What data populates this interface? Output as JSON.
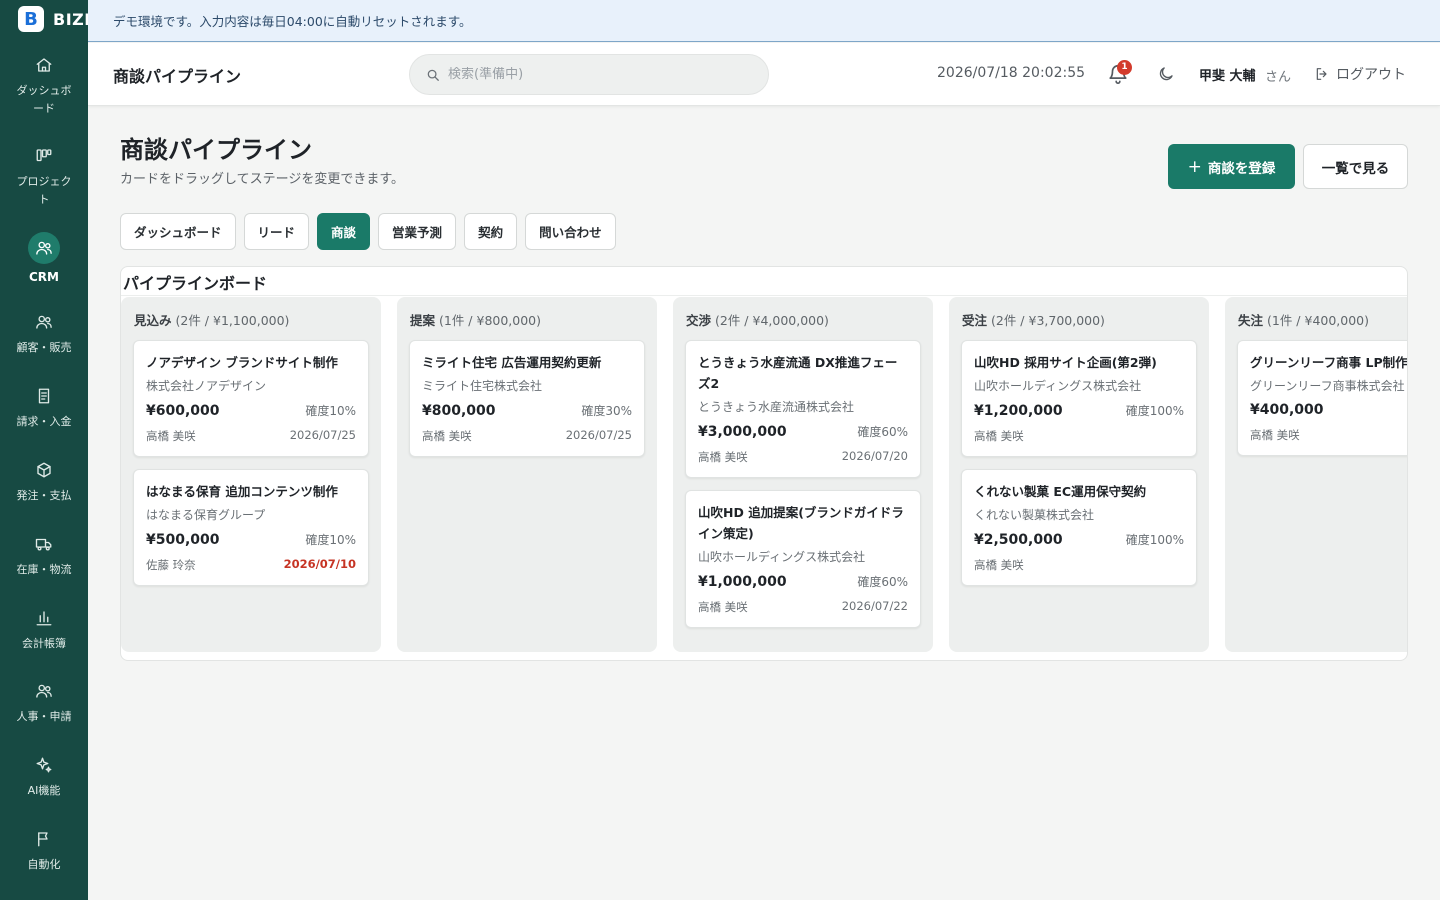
{
  "app": {
    "logo_letter": "B",
    "logo_text": "BIZR"
  },
  "banner": {
    "text": "デモ環境です。入力内容は毎日04:00に自動リセットされます。"
  },
  "sidebar": {
    "items": [
      {
        "label": "ダッシュボード",
        "icon": "home-icon"
      },
      {
        "label": "プロジェクト",
        "icon": "kanban-icon"
      },
      {
        "label": "CRM",
        "icon": "users-icon",
        "active": true
      },
      {
        "label": "顧客・販売",
        "icon": "users-icon"
      },
      {
        "label": "請求・入金",
        "icon": "invoice-icon"
      },
      {
        "label": "発注・支払",
        "icon": "box-icon"
      },
      {
        "label": "在庫・物流",
        "icon": "truck-icon"
      },
      {
        "label": "会計帳簿",
        "icon": "chart-icon"
      },
      {
        "label": "人事・申請",
        "icon": "people-icon"
      },
      {
        "label": "AI機能",
        "icon": "sparkle-icon"
      },
      {
        "label": "自動化",
        "icon": "flag-icon"
      }
    ]
  },
  "header": {
    "title": "商談パイプライン",
    "search_placeholder": "検索(準備中)",
    "datetime": "2026/07/18 20:02:55",
    "notification_count": "1",
    "user_name": "甲斐 大輔",
    "user_suffix": "さん",
    "logout_label": "ログアウト"
  },
  "page": {
    "title": "商談パイプライン",
    "subtitle": "カードをドラッグしてステージを変更できます。",
    "primary_button": "商談を登録",
    "primary_button_icon": "+",
    "secondary_button": "一覧で見る"
  },
  "tabs": [
    {
      "label": "ダッシュボード"
    },
    {
      "label": "リード"
    },
    {
      "label": "商談",
      "active": true
    },
    {
      "label": "営業予測"
    },
    {
      "label": "契約"
    },
    {
      "label": "問い合わせ"
    }
  ],
  "board": {
    "title": "パイプラインボード",
    "lanes": [
      {
        "name": "見込み",
        "summary": "(2件 / ¥1,100,000)",
        "cards": [
          {
            "title": "ノアデザイン ブランドサイト制作",
            "company": "株式会社ノアデザイン",
            "amount": "¥600,000",
            "probability": "確度10%",
            "owner": "高橋 美咲",
            "date": "2026/07/25",
            "overdue": false
          },
          {
            "title": "はなまる保育 追加コンテンツ制作",
            "company": "はなまる保育グループ",
            "amount": "¥500,000",
            "probability": "確度10%",
            "owner": "佐藤 玲奈",
            "date": "2026/07/10",
            "overdue": true
          }
        ]
      },
      {
        "name": "提案",
        "summary": "(1件 / ¥800,000)",
        "cards": [
          {
            "title": "ミライト住宅 広告運用契約更新",
            "company": "ミライト住宅株式会社",
            "amount": "¥800,000",
            "probability": "確度30%",
            "owner": "高橋 美咲",
            "date": "2026/07/25",
            "overdue": false
          }
        ]
      },
      {
        "name": "交渉",
        "summary": "(2件 / ¥4,000,000)",
        "cards": [
          {
            "title": "とうきょう水産流通 DX推進フェーズ2",
            "company": "とうきょう水産流通株式会社",
            "amount": "¥3,000,000",
            "probability": "確度60%",
            "owner": "高橋 美咲",
            "date": "2026/07/20",
            "overdue": false
          },
          {
            "title": "山吹HD 追加提案(ブランドガイドライン策定)",
            "company": "山吹ホールディングス株式会社",
            "amount": "¥1,000,000",
            "probability": "確度60%",
            "owner": "高橋 美咲",
            "date": "2026/07/22",
            "overdue": false
          }
        ]
      },
      {
        "name": "受注",
        "summary": "(2件 / ¥3,700,000)",
        "cards": [
          {
            "title": "山吹HD 採用サイト企画(第2弾)",
            "company": "山吹ホールディングス株式会社",
            "amount": "¥1,200,000",
            "probability": "確度100%",
            "owner": "高橋 美咲",
            "date": "",
            "overdue": false
          },
          {
            "title": "くれない製菓 EC運用保守契約",
            "company": "くれない製菓株式会社",
            "amount": "¥2,500,000",
            "probability": "確度100%",
            "owner": "高橋 美咲",
            "date": "",
            "overdue": false
          }
        ]
      },
      {
        "name": "失注",
        "summary": "(1件 / ¥400,000)",
        "cards": [
          {
            "title": "グリーンリーフ商事 LP制作",
            "company": "グリーンリーフ商事株式会社",
            "amount": "¥400,000",
            "probability": "",
            "owner": "高橋 美咲",
            "date": "",
            "overdue": false
          }
        ]
      }
    ]
  },
  "colors": {
    "sidebar": "#174a43",
    "accent": "#1a7a68",
    "banner": "#e8f1fb",
    "overdue": "#c63424",
    "badge": "#d33b2c"
  }
}
